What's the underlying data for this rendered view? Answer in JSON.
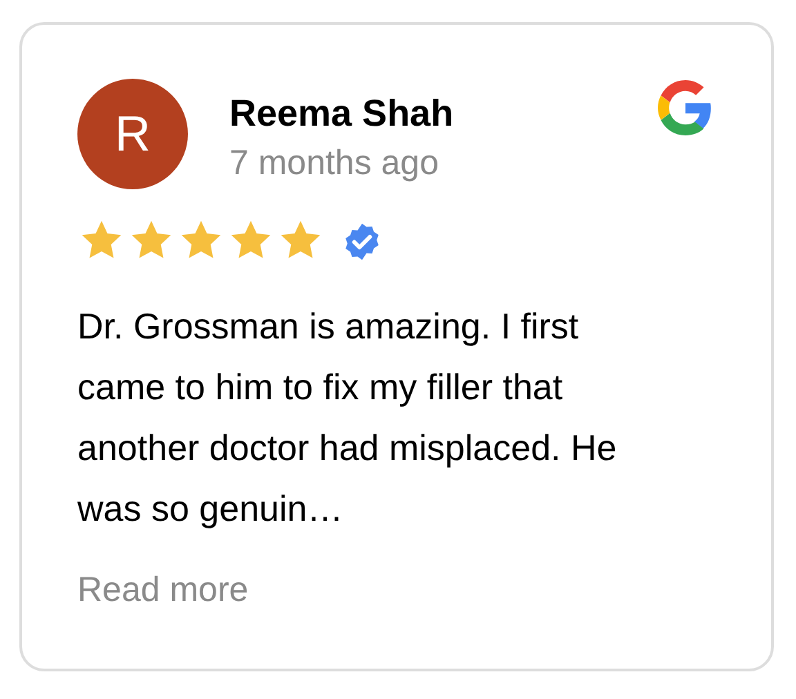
{
  "review": {
    "avatar_letter": "R",
    "author": "Reema Shah",
    "time": "7 months ago",
    "stars": 5,
    "verified": true,
    "text": "Dr. Grossman is amazing. I first came to him to fix my filler that another doctor had misplaced. He was so genuin…",
    "read_more": "Read more"
  }
}
